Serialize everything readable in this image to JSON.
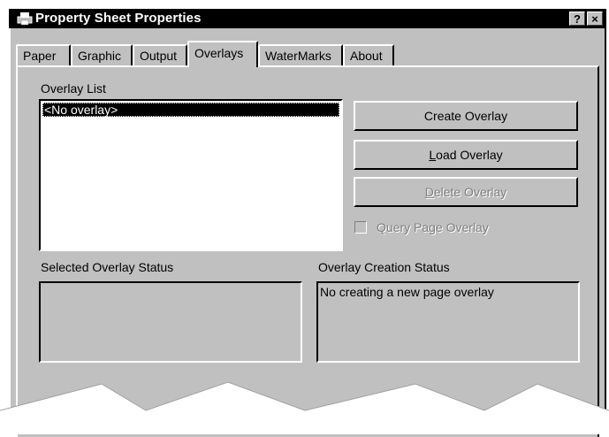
{
  "window": {
    "title": "Property Sheet Properties",
    "help_button": "?",
    "close_button": "×"
  },
  "tabs": [
    {
      "label": "Paper"
    },
    {
      "label": "Graphic"
    },
    {
      "label": "Output"
    },
    {
      "label": "Overlays",
      "active": true
    },
    {
      "label": "WaterMarks"
    },
    {
      "label": "About"
    }
  ],
  "overlay_list": {
    "label": "Overlay List",
    "items": [
      "<No overlay>"
    ],
    "selected_index": 0
  },
  "buttons": {
    "create_overlay": {
      "pre": "Create Overlay",
      "acc": "",
      "post": ""
    },
    "load_overlay": {
      "pre": "",
      "acc": "L",
      "post": "oad Overlay"
    },
    "delete_overlay": {
      "pre": "",
      "acc": "D",
      "post": "elete Overlay",
      "enabled": false
    }
  },
  "query_page_overlay": {
    "label": "Query Page Overlay",
    "checked": false,
    "enabled": false
  },
  "selected_overlay_status": {
    "label": "Selected Overlay Status",
    "text": ""
  },
  "overlay_creation_status": {
    "label": "Overlay Creation Status",
    "text": "No creating a new page overlay"
  },
  "colors": {
    "face": "#c0c0c0",
    "titlebar": "#000000",
    "selection": "#000000"
  }
}
